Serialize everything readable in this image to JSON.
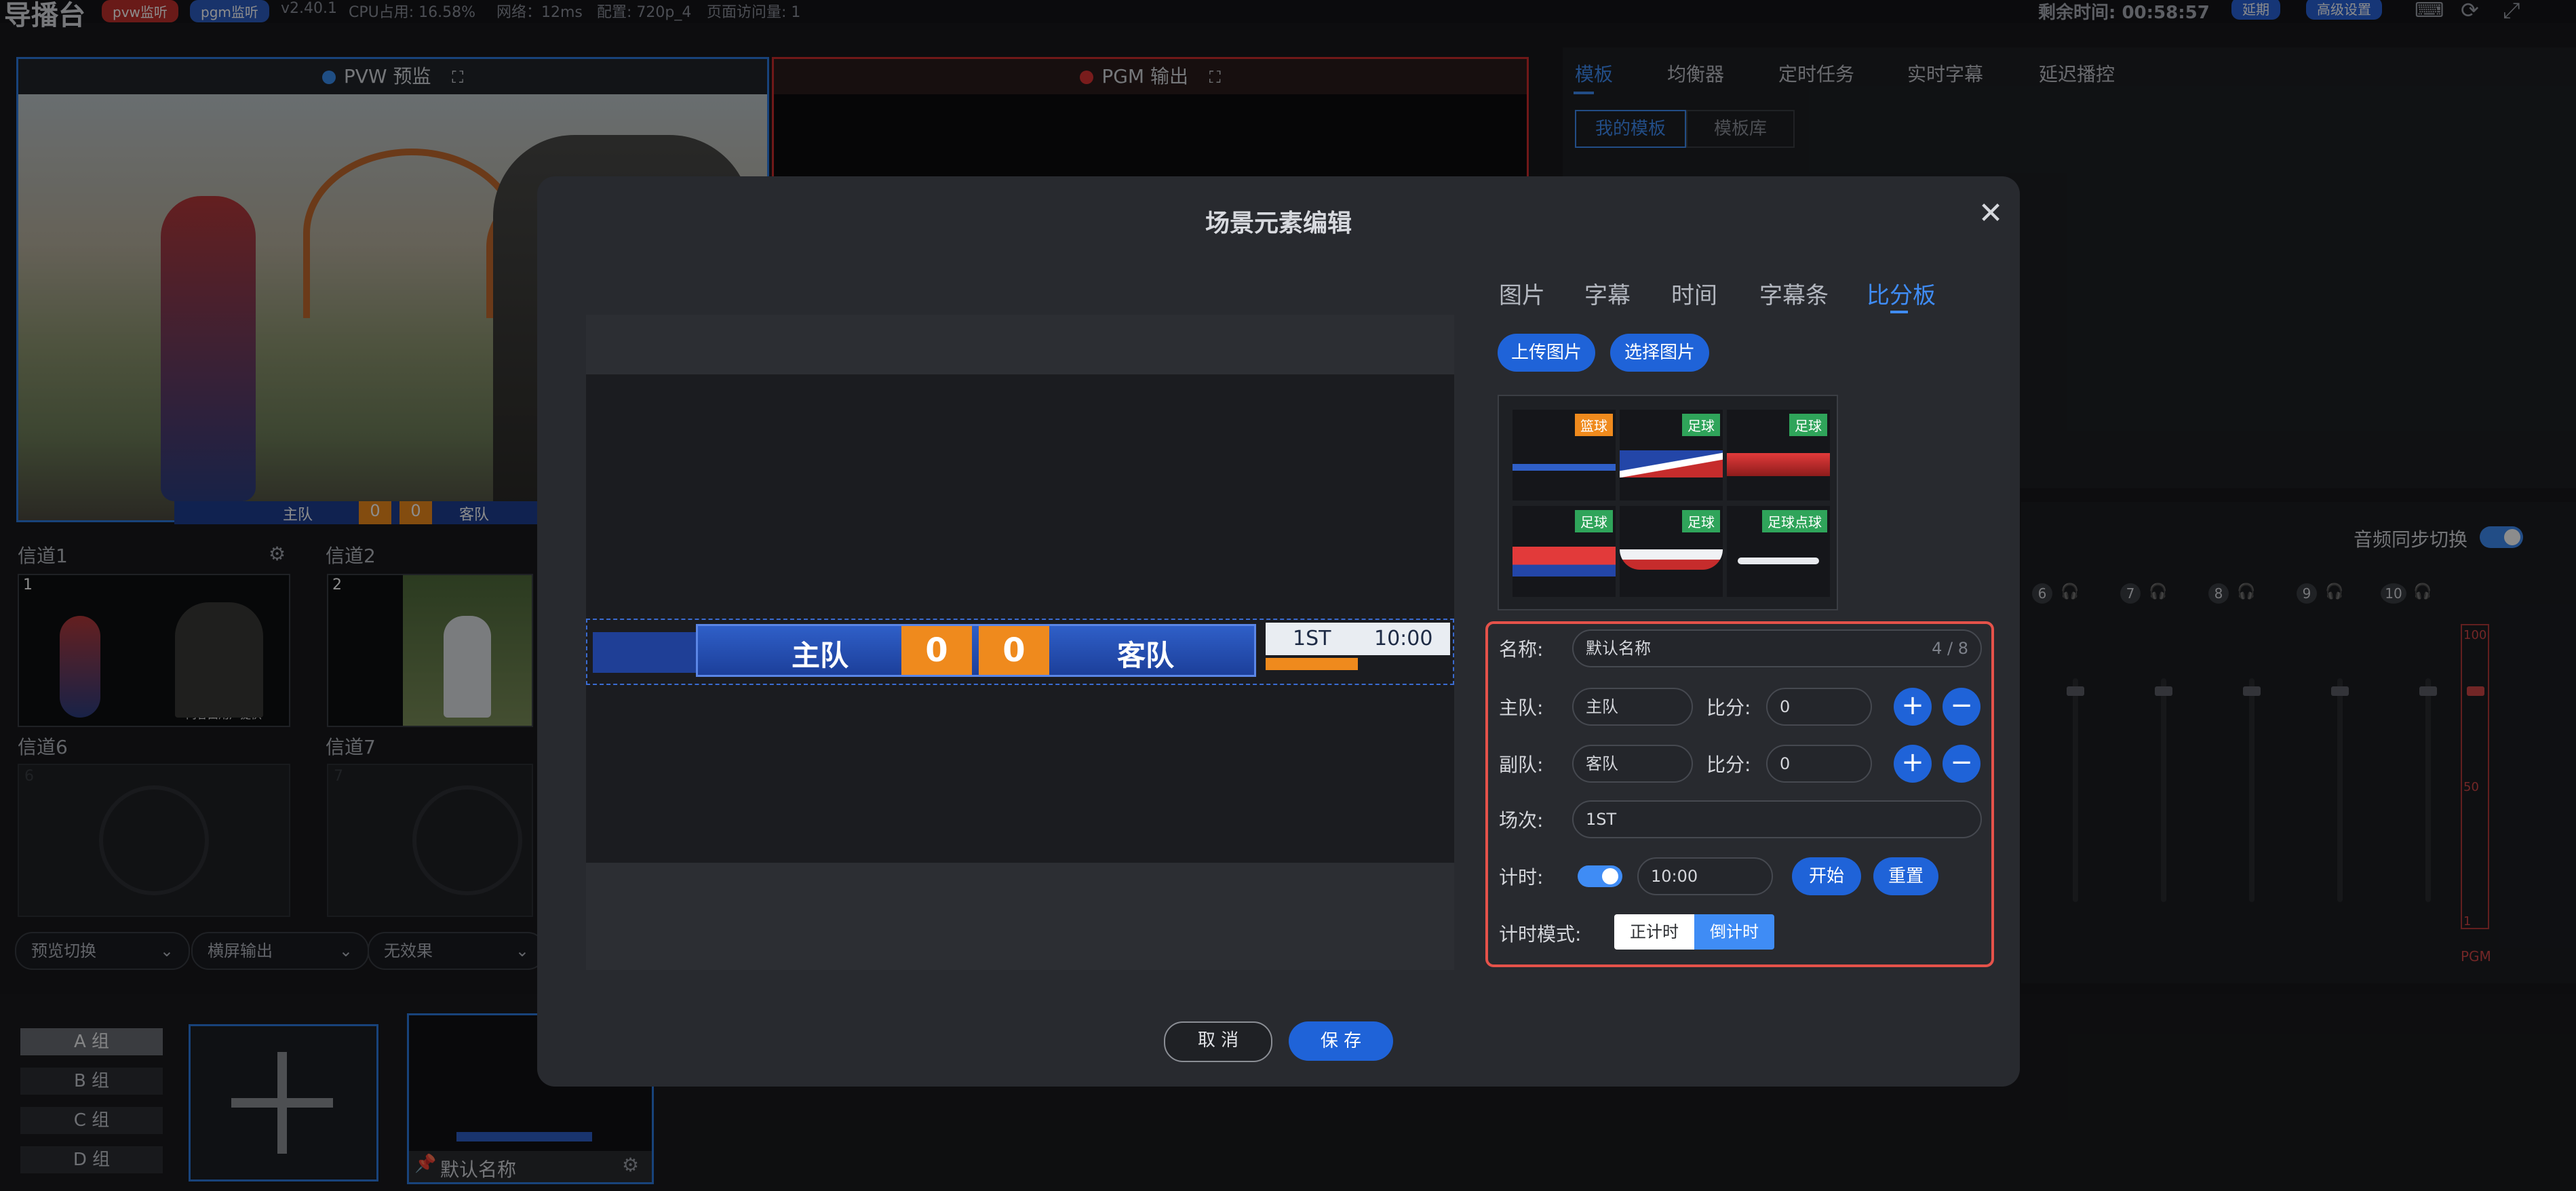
{
  "topbar": {
    "title": "导播台",
    "badge_pvw": "pvw监听",
    "badge_pgm": "pgm监听",
    "version": "v2.40.1",
    "cpu": "CPU占用: 16.58%",
    "network": "网络：12ms",
    "config": "配置: 720p_4",
    "visits": "页面访问量: 1",
    "remaining": "剩余时间: 00:58:57",
    "btn_delay": "延期",
    "btn_advanced": "高级设置"
  },
  "monitors": {
    "pvw_title": "PVW 预监",
    "pgm_title": "PGM 输出",
    "pvw_home": "主队",
    "pvw_away": "客队",
    "pvw_home_score": "0",
    "pvw_away_score": "0"
  },
  "right_panel": {
    "tabs": [
      "模板",
      "均衡器",
      "定时任务",
      "实时字幕",
      "延迟播控"
    ],
    "subtabs": [
      "我的模板",
      "模板库"
    ]
  },
  "channels": {
    "ch1": "信道1",
    "ch2": "信道2",
    "ch6": "信道6",
    "ch7": "信道7",
    "ch1_num": "1",
    "ch2_num": "2",
    "ch6_num": "6",
    "ch7_num": "7",
    "ch1_overlay": "内容由用户提供"
  },
  "controls": {
    "select1": "预览切换",
    "select2": "横屏输出",
    "select3": "无效果"
  },
  "groups": [
    "A 组",
    "B 组",
    "C 组",
    "D 组"
  ],
  "scene_card": {
    "name": "默认名称"
  },
  "audio": {
    "sync_label": "音频同步切换",
    "channels": [
      "6",
      "7",
      "8",
      "9",
      "10"
    ],
    "pgm_label": "PGM",
    "scale_top": "100",
    "scale_mid": "50",
    "scale_bottom": "1"
  },
  "modal": {
    "title": "场景元素编辑",
    "tabs": [
      "图片",
      "字幕",
      "时间",
      "字幕条",
      "比分板"
    ],
    "btn_upload": "上传图片",
    "btn_select": "选择图片",
    "templates": [
      {
        "tag": "篮球",
        "color": "#ef8a1d"
      },
      {
        "tag": "足球",
        "color": "#2fa45a"
      },
      {
        "tag": "足球",
        "color": "#2fa45a"
      },
      {
        "tag": "足球",
        "color": "#2fa45a"
      },
      {
        "tag": "足球",
        "color": "#2fa45a"
      },
      {
        "tag": "足球点球",
        "color": "#2fa45a"
      }
    ],
    "preview": {
      "home": "主队",
      "away": "客队",
      "home_score": "0",
      "away_score": "0",
      "period": "1ST",
      "time": "10:00"
    },
    "form": {
      "name_label": "名称:",
      "name_value": "默认名称",
      "name_count": "4 / 8",
      "home_label": "主队:",
      "home_value": "主队",
      "score_label": "比分:",
      "home_score": "0",
      "away_label": "副队:",
      "away_value": "客队",
      "away_score": "0",
      "period_label": "场次:",
      "period_value": "1ST",
      "timer_label": "计时:",
      "timer_value": "10:00",
      "timer_enabled": true,
      "btn_start": "开始",
      "btn_reset": "重置",
      "mode_label": "计时模式:",
      "mode_up": "正计时",
      "mode_down": "倒计时",
      "mode_selected": "倒计时"
    },
    "btn_cancel": "取 消",
    "btn_save": "保 存"
  },
  "colors": {
    "accent": "#3f8cf5",
    "primary_button": "#1f63d8",
    "pvw_border": "#2d7be0",
    "pgm_border": "#cc2d2d",
    "highlight_border": "#e5524a",
    "score_orange": "#ef8a1d"
  }
}
